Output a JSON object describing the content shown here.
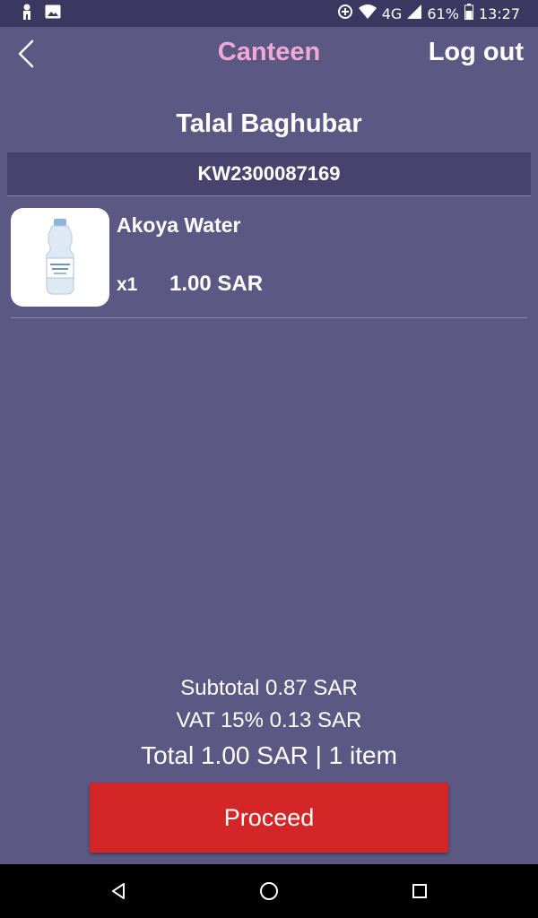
{
  "status_bar": {
    "network": "4G",
    "battery": "61%",
    "time": "13:27",
    "icons": [
      "person-icon",
      "image-icon",
      "data-saver-icon",
      "wifi-icon",
      "signal-icon",
      "battery-icon"
    ]
  },
  "app_bar": {
    "title": "Canteen",
    "logout_label": "Log out",
    "back_icon": "chevron-left-icon"
  },
  "customer": {
    "name": "Talal Baghubar",
    "id": "KW2300087169"
  },
  "cart": {
    "items": [
      {
        "name": "Akoya Water",
        "quantity": "x1",
        "price": "1.00 SAR",
        "image": "water-bottle"
      }
    ]
  },
  "summary": {
    "subtotal": "Subtotal 0.87 SAR",
    "vat": "VAT 15% 0.13 SAR",
    "total": "Total 1.00 SAR | 1 item"
  },
  "actions": {
    "proceed_label": "Proceed"
  },
  "colors": {
    "background": "#5b5883",
    "status_bar": "#3a3760",
    "title": "#f2a8d5",
    "id_bar": "#48436d",
    "proceed": "#d42626"
  }
}
